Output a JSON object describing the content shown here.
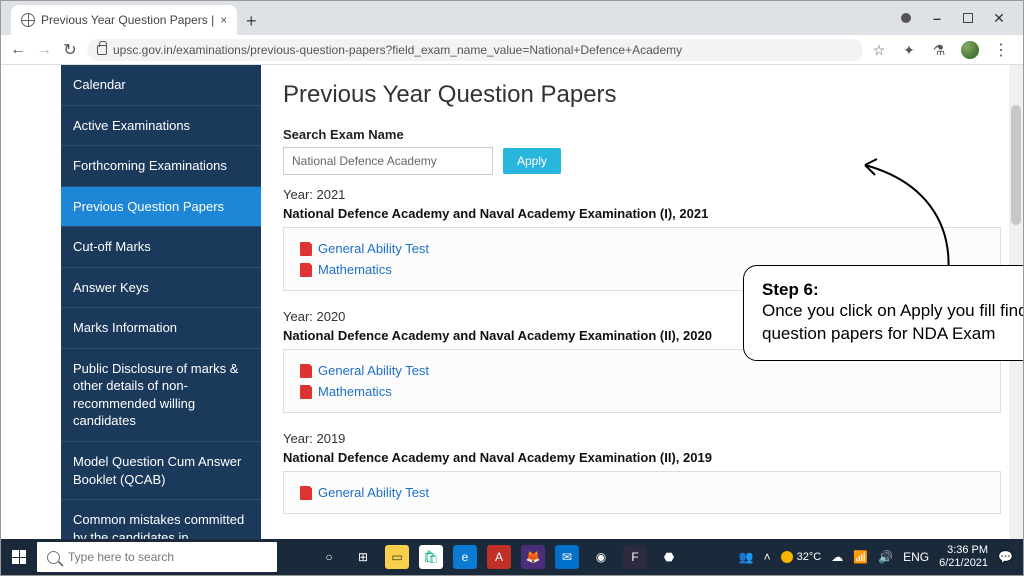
{
  "browser": {
    "tab_title": "Previous Year Question Papers | ",
    "url": "upsc.gov.in/examinations/previous-question-papers?field_exam_name_value=National+Defence+Academy"
  },
  "sidebar": {
    "items": [
      {
        "label": "Calendar"
      },
      {
        "label": "Active Examinations"
      },
      {
        "label": "Forthcoming Examinations"
      },
      {
        "label": "Previous Question Papers"
      },
      {
        "label": "Cut-off Marks"
      },
      {
        "label": "Answer Keys"
      },
      {
        "label": "Marks Information"
      },
      {
        "label": "Public Disclosure of marks & other details of non-recommended willing candidates"
      },
      {
        "label": "Model Question Cum Answer Booklet (QCAB)"
      },
      {
        "label": "Common mistakes committed by the candidates in"
      }
    ],
    "active_index": 3
  },
  "main": {
    "heading": "Previous Year Question Papers",
    "search_label": "Search Exam Name",
    "search_value": "National Defence Academy",
    "apply_label": "Apply"
  },
  "results": [
    {
      "year_label": "Year: 2021",
      "exam_title": "National Defence Academy and Naval Academy Examination (I), 2021",
      "papers": [
        "General Ability Test",
        "Mathematics"
      ]
    },
    {
      "year_label": "Year: 2020",
      "exam_title": "National Defence Academy and Naval Academy Examination (II), 2020",
      "papers": [
        "General Ability Test",
        "Mathematics"
      ]
    },
    {
      "year_label": "Year: 2019",
      "exam_title": "National Defence Academy and Naval Academy Examination (II), 2019",
      "papers": [
        "General Ability Test"
      ]
    }
  ],
  "callout": {
    "step": "Step 6:",
    "desc": "Once you click on Apply you fill find all the  question papers for NDA Exam"
  },
  "taskbar": {
    "search_placeholder": "Type here to search",
    "weather": "32°C",
    "lang": "ENG",
    "time": "3:36 PM",
    "date": "6/21/2021"
  }
}
